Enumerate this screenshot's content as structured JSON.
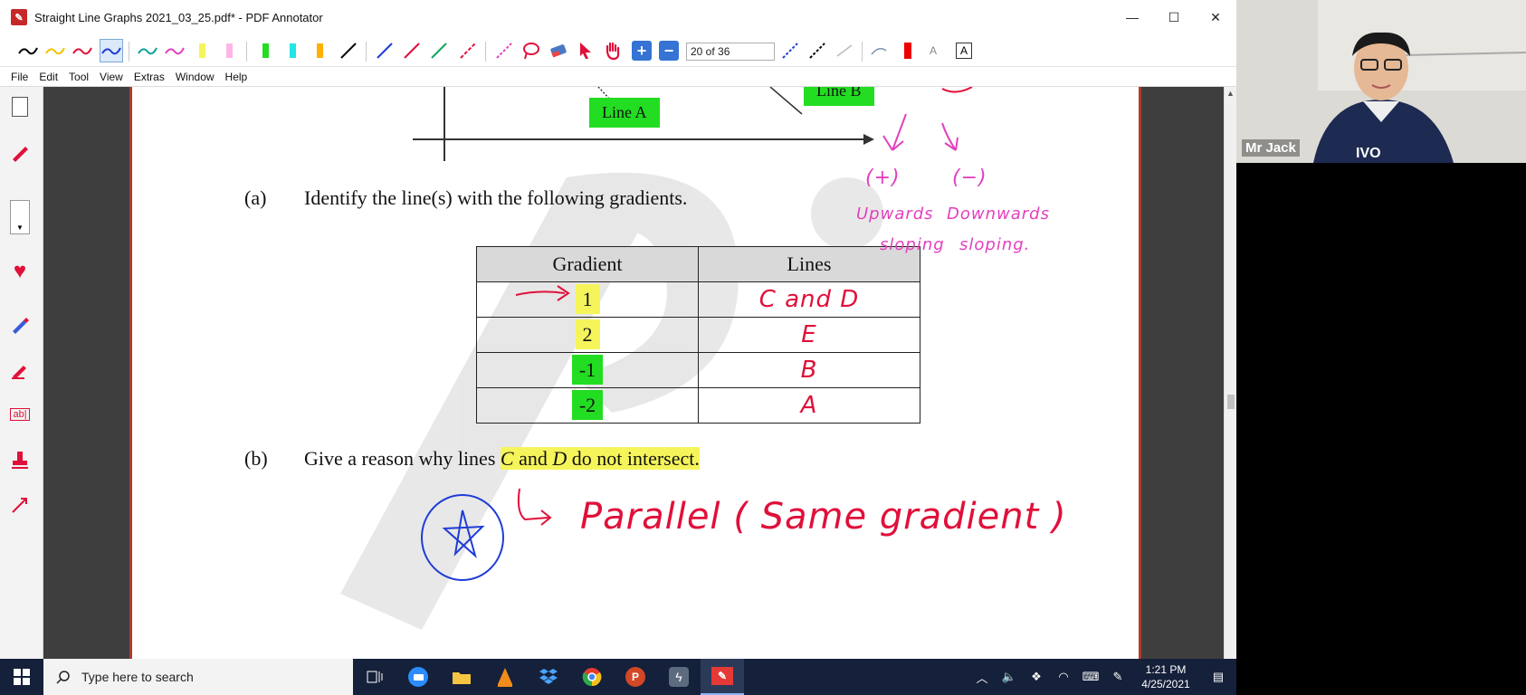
{
  "window": {
    "title": "Straight Line Graphs 2021_03_25.pdf* - PDF Annotator",
    "app_icon": "pdf-annotator-icon",
    "controls": {
      "minimize": "—",
      "maximize": "☐",
      "close": "✕"
    }
  },
  "toolbar": {
    "page_indicator": "20 of 36",
    "zoom_in": "+",
    "zoom_out": "−",
    "pen_colors": [
      "#000000",
      "#f2c200",
      "#e0103a",
      "#3a5bd9",
      "#0fa39a",
      "#e33fbd"
    ],
    "highlighter_colors": [
      "#f5f55b",
      "#ffb6e6",
      "#22dd22",
      "#22e6e6",
      "#ffb000"
    ],
    "line_colors": [
      "#000000",
      "#1f3cd6",
      "#e0103a",
      "#0fa860",
      "#e0103a",
      "#e33fbd"
    ]
  },
  "menu": {
    "items": [
      {
        "label": "File",
        "key": "F"
      },
      {
        "label": "Edit",
        "key": "E"
      },
      {
        "label": "Tool",
        "key": "T"
      },
      {
        "label": "View",
        "key": "V"
      },
      {
        "label": "Extras",
        "key": "x"
      },
      {
        "label": "Window",
        "key": "W"
      },
      {
        "label": "Help",
        "key": "H"
      }
    ]
  },
  "document": {
    "graph_labels": {
      "line_a": "Line A",
      "line_b": "Line B"
    },
    "question_a": {
      "num": "(a)",
      "text": "Identify the line(s) with the following gradients."
    },
    "table": {
      "headers": [
        "Gradient",
        "Lines"
      ],
      "rows": [
        {
          "gradient": "1",
          "lines": "C and D",
          "highlight": "#f5f55b"
        },
        {
          "gradient": "2",
          "lines": "E",
          "highlight": "#f5f55b"
        },
        {
          "gradient": "-1",
          "lines": "B",
          "highlight": "#22dd22"
        },
        {
          "gradient": "-2",
          "lines": "A",
          "highlight": "#22dd22"
        }
      ]
    },
    "question_b": {
      "num": "(b)",
      "prefix": "Give a reason why lines ",
      "c": "C",
      "and": " and ",
      "d": "D",
      "suffix": " do not intersect."
    },
    "annotations": {
      "positive": "(+)",
      "negative": "(−)",
      "upwards": "Upwards",
      "downwards": "Downwards",
      "sloping_1": "sloping",
      "sloping_2": "sloping.",
      "answer_b": "Parallel ( Same gradient )"
    }
  },
  "webcam": {
    "name": "Mr Jack"
  },
  "taskbar": {
    "search_placeholder": "Type here to search",
    "time": "1:21 PM",
    "date": "4/25/2021",
    "apps": [
      "task-view",
      "zoom",
      "file-explorer",
      "vlc",
      "dropbox",
      "chrome",
      "powerpoint",
      "app-bolt",
      "pdf-annotator"
    ]
  }
}
